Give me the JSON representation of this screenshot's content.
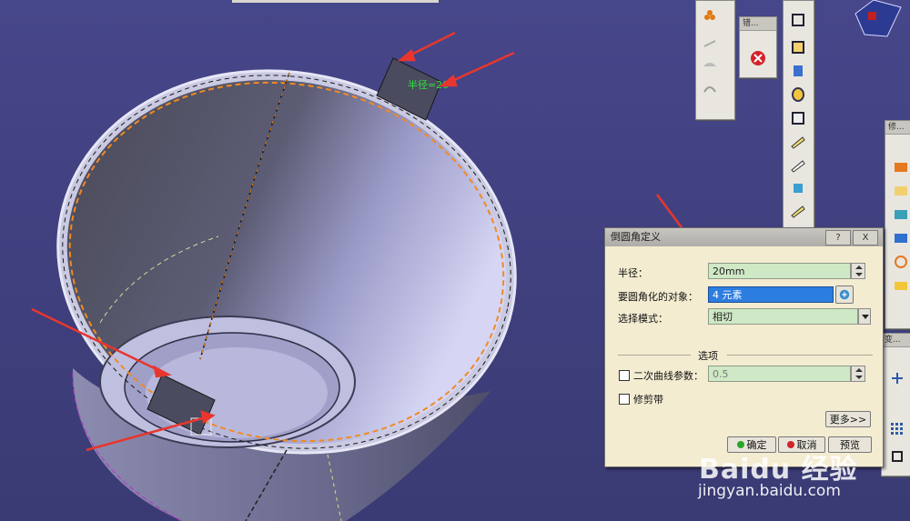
{
  "dialog": {
    "title": "倒圆角定义",
    "help": "?",
    "close": "X",
    "radius_label": "半径：",
    "radius_value": "20mm",
    "objects_label": "要圆角化的对象：",
    "objects_value": "4 元素",
    "mode_label": "选择模式：",
    "mode_value": "相切",
    "options_label": "选项",
    "conic_label": "二次曲线参数：",
    "conic_value": "0.5",
    "trim_label": "修剪带",
    "more_label": "更多>>",
    "ok_label": "确定",
    "cancel_label": "取消",
    "preview_label": "预览"
  },
  "viewport": {
    "radius_annotation": "半径=20"
  },
  "toolbars": {
    "error_title": "错...",
    "modify_title": "修...",
    "lower_title": "变..."
  },
  "watermark": {
    "logo": "Baidu 经验",
    "url": "jingyan.baidu.com"
  },
  "colors": {
    "background": "#3f3f7e",
    "part_light": "#d0d0ec",
    "part_dark": "#4a4a60",
    "edge_highlight": "#f08a24",
    "arrow": "#e8362e",
    "dialog_bg": "#f4ecd1",
    "field_bg": "#cfe8c5",
    "selection": "#2d7de0"
  }
}
